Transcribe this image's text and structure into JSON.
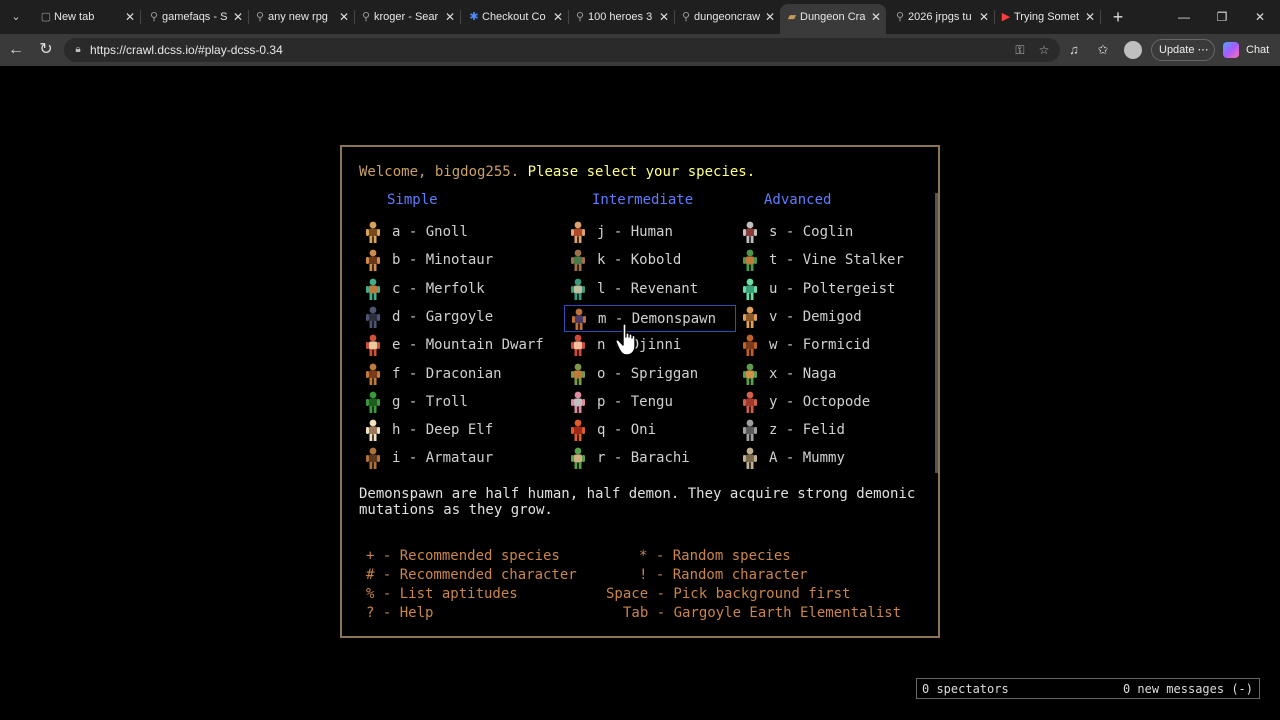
{
  "browser": {
    "tabs": [
      {
        "title": "New tab",
        "icon": "page-icon"
      },
      {
        "title": "gamefaqs - S",
        "icon": "search-icon"
      },
      {
        "title": "any new rpg",
        "icon": "search-icon"
      },
      {
        "title": "kroger - Sear",
        "icon": "search-icon"
      },
      {
        "title": "Checkout Co",
        "icon": "walmart-icon"
      },
      {
        "title": "100 heroes 3",
        "icon": "search-icon"
      },
      {
        "title": "dungeoncraw",
        "icon": "search-icon"
      },
      {
        "title": "Dungeon Cra",
        "icon": "dcss-icon"
      },
      {
        "title": "2026 jrpgs tu",
        "icon": "search-icon"
      },
      {
        "title": "Trying Somet",
        "icon": "youtube-icon"
      }
    ],
    "active_tab_index": 7,
    "url": "https://crawl.dcss.io/#play-dcss-0.34",
    "update_label": "Update",
    "chat_label": "Chat"
  },
  "game": {
    "welcome_prefix": "Welcome, bigdog255.",
    "welcome_prompt": "Please select your species.",
    "columns": [
      {
        "heading": "Simple",
        "species": [
          {
            "key": "a",
            "name": "Gnoll"
          },
          {
            "key": "b",
            "name": "Minotaur"
          },
          {
            "key": "c",
            "name": "Merfolk"
          },
          {
            "key": "d",
            "name": "Gargoyle"
          },
          {
            "key": "e",
            "name": "Mountain Dwarf"
          },
          {
            "key": "f",
            "name": "Draconian"
          },
          {
            "key": "g",
            "name": "Troll"
          },
          {
            "key": "h",
            "name": "Deep Elf"
          },
          {
            "key": "i",
            "name": "Armataur"
          }
        ]
      },
      {
        "heading": "Intermediate",
        "species": [
          {
            "key": "j",
            "name": "Human"
          },
          {
            "key": "k",
            "name": "Kobold"
          },
          {
            "key": "l",
            "name": "Revenant"
          },
          {
            "key": "m",
            "name": "Demonspawn"
          },
          {
            "key": "n",
            "name": "Djinni"
          },
          {
            "key": "o",
            "name": "Spriggan"
          },
          {
            "key": "p",
            "name": "Tengu"
          },
          {
            "key": "q",
            "name": "Oni"
          },
          {
            "key": "r",
            "name": "Barachi"
          }
        ]
      },
      {
        "heading": "Advanced",
        "species": [
          {
            "key": "s",
            "name": "Coglin"
          },
          {
            "key": "t",
            "name": "Vine Stalker"
          },
          {
            "key": "u",
            "name": "Poltergeist"
          },
          {
            "key": "v",
            "name": "Demigod"
          },
          {
            "key": "w",
            "name": "Formicid"
          },
          {
            "key": "x",
            "name": "Naga"
          },
          {
            "key": "y",
            "name": "Octopode"
          },
          {
            "key": "z",
            "name": "Felid"
          },
          {
            "key": "A",
            "name": "Mummy"
          }
        ]
      }
    ],
    "selected_key": "m",
    "description_line1": "Demonspawn are half human, half demon. They acquire strong demonic",
    "description_line2": "mutations as they grow.",
    "options": {
      "recommended_species": "+ - Recommended species",
      "random_species": "* - Random species",
      "recommended_character": "# - Recommended character",
      "random_character": "! - Random character",
      "list_aptitudes": "% - List aptitudes",
      "pick_background": "Space - Pick background first",
      "help": "? - Help",
      "tab_char": "Tab - Gargoyle Earth Elementalist"
    },
    "spectators": "0 spectators",
    "new_messages": "0 new messages (-)"
  }
}
